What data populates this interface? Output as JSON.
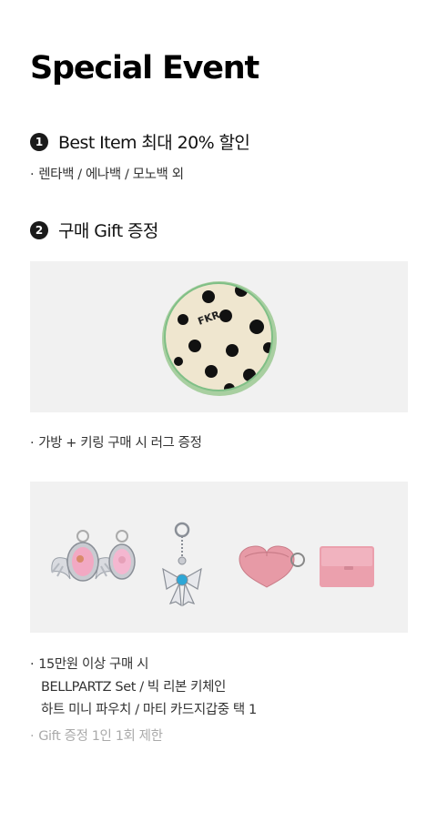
{
  "title": "Special Event",
  "sections": [
    {
      "number": "1",
      "title": "Best Item 최대 20% 할인",
      "bullet": "렌타백 / 에나백 / 모노백 외"
    },
    {
      "number": "2",
      "title": "구매 Gift 증정",
      "gift1": {
        "rug_letters": "FKR",
        "caption": "가방 + 키링 구매 시 러그 증정"
      },
      "gift2": {
        "caption_line1": "15만원 이상 구매 시",
        "caption_line2": "BELLPARTZ Set / 빅 리본 키체인",
        "caption_line3": "하트 미니 파우치 / 마티 카드지갑중 택 1",
        "note": "Gift 증정 1인 1회 제한"
      }
    }
  ],
  "bullet_mark": "·",
  "colors": {
    "image_bg": "#f1f1f1",
    "badge": "#1a1a1a",
    "note": "#aaaaaa",
    "pink": "#e79aa6"
  },
  "icons": [
    "rug-image",
    "bellpartz-image",
    "ribbon-keychain-image",
    "heart-pouch-image",
    "card-wallet-image"
  ]
}
